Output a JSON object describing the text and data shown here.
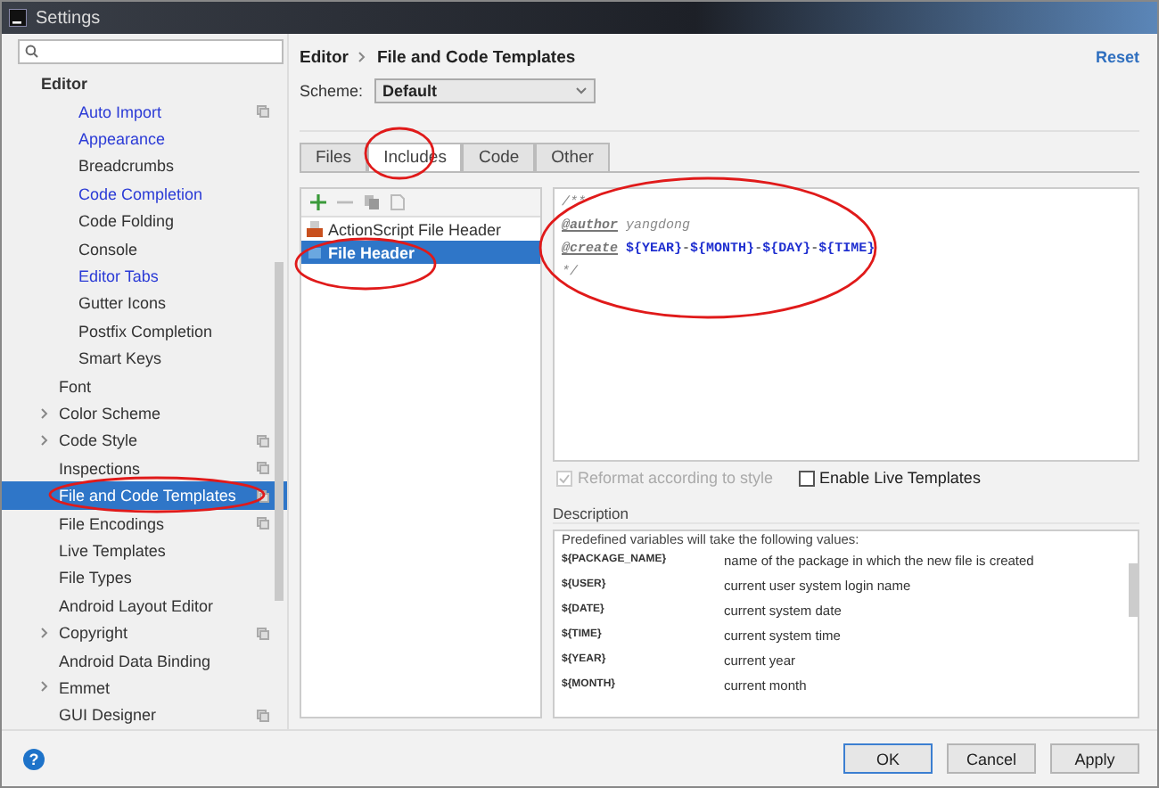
{
  "window": {
    "title": "Settings"
  },
  "sidebar": {
    "items": [
      {
        "label": "Editor",
        "bold": true,
        "expandable": false,
        "copy": false,
        "modified": false,
        "selected": false,
        "circled": false,
        "children": [
          {
            "label": "Auto Import",
            "modified": true,
            "copy": true,
            "selected": false,
            "circled": false
          },
          {
            "label": "Appearance",
            "modified": true,
            "copy": false,
            "selected": false,
            "circled": false
          },
          {
            "label": "Breadcrumbs",
            "modified": false,
            "copy": false,
            "selected": false,
            "circled": false
          },
          {
            "label": "Code Completion",
            "modified": true,
            "copy": false,
            "selected": false,
            "circled": false
          },
          {
            "label": "Code Folding",
            "modified": false,
            "copy": false,
            "selected": false,
            "circled": false
          },
          {
            "label": "Console",
            "modified": false,
            "copy": false,
            "selected": false,
            "circled": false
          },
          {
            "label": "Editor Tabs",
            "modified": true,
            "copy": false,
            "selected": false,
            "circled": false
          },
          {
            "label": "Gutter Icons",
            "modified": false,
            "copy": false,
            "selected": false,
            "circled": false
          },
          {
            "label": "Postfix Completion",
            "modified": false,
            "copy": false,
            "selected": false,
            "circled": false
          },
          {
            "label": "Smart Keys",
            "modified": false,
            "copy": false,
            "selected": false,
            "circled": false
          }
        ]
      },
      {
        "label": "Font",
        "expandable": false,
        "copy": false,
        "modified": false,
        "selected": false,
        "circled": false
      },
      {
        "label": "Color Scheme",
        "expandable": true,
        "copy": false,
        "modified": false,
        "selected": false,
        "circled": false
      },
      {
        "label": "Code Style",
        "expandable": true,
        "copy": true,
        "modified": false,
        "selected": false,
        "circled": false
      },
      {
        "label": "Inspections",
        "expandable": false,
        "copy": true,
        "modified": false,
        "selected": false,
        "circled": false
      },
      {
        "label": "File and Code Templates",
        "expandable": false,
        "copy": true,
        "modified": false,
        "selected": true,
        "circled": true
      },
      {
        "label": "File Encodings",
        "expandable": false,
        "copy": true,
        "modified": false,
        "selected": false,
        "circled": false
      },
      {
        "label": "Live Templates",
        "expandable": false,
        "copy": false,
        "modified": false,
        "selected": false,
        "circled": false
      },
      {
        "label": "File Types",
        "expandable": false,
        "copy": false,
        "modified": false,
        "selected": false,
        "circled": false
      },
      {
        "label": "Android Layout Editor",
        "expandable": false,
        "copy": false,
        "modified": false,
        "selected": false,
        "circled": false
      },
      {
        "label": "Copyright",
        "expandable": true,
        "copy": true,
        "modified": false,
        "selected": false,
        "circled": false
      },
      {
        "label": "Android Data Binding",
        "expandable": false,
        "copy": false,
        "modified": false,
        "selected": false,
        "circled": false
      },
      {
        "label": "Emmet",
        "expandable": true,
        "copy": false,
        "modified": false,
        "selected": false,
        "circled": false
      },
      {
        "label": "GUI Designer",
        "expandable": false,
        "copy": true,
        "modified": false,
        "selected": false,
        "circled": false
      }
    ]
  },
  "breadcrumb": [
    "Editor",
    "File and Code Templates"
  ],
  "reset": "Reset",
  "scheme": {
    "label": "Scheme:",
    "value": "Default"
  },
  "tabs": [
    {
      "label": "Files",
      "selected": false,
      "circled": false
    },
    {
      "label": "Includes",
      "selected": true,
      "circled": true
    },
    {
      "label": "Code",
      "selected": false,
      "circled": false
    },
    {
      "label": "Other",
      "selected": false,
      "circled": false
    }
  ],
  "templates": [
    {
      "label": "ActionScript File Header",
      "kind": "actionscript",
      "selected": false,
      "circled": false
    },
    {
      "label": "File Header",
      "kind": "file",
      "selected": true,
      "circled": true
    }
  ],
  "editor": {
    "circled": true,
    "lines": [
      [
        {
          "kind": "comment",
          "text": "/**"
        }
      ],
      [
        {
          "kind": "tag",
          "text": "@author"
        },
        {
          "kind": "comment",
          "text": "yangdong"
        }
      ],
      [
        {
          "kind": "tag",
          "text": "@create"
        },
        {
          "kind": "variable",
          "text": "${YEAR}"
        },
        {
          "kind": "plain",
          "text": "-"
        },
        {
          "kind": "variable",
          "text": "${MONTH}"
        },
        {
          "kind": "plain",
          "text": "-"
        },
        {
          "kind": "variable",
          "text": "${DAY}"
        },
        {
          "kind": "plain",
          "text": "-"
        },
        {
          "kind": "variable",
          "text": "${TIME}"
        }
      ],
      [
        {
          "kind": "comment",
          "text": "*/"
        }
      ]
    ]
  },
  "options": [
    {
      "label": "Reformat according to style",
      "checked": true,
      "disabled": true
    },
    {
      "label": "Enable Live Templates",
      "checked": false,
      "disabled": false
    }
  ],
  "description": {
    "title": "Description",
    "intro": "Predefined variables will take the following values:",
    "rows": [
      {
        "name": "${PACKAGE_NAME}",
        "text": "name of the package in which the new file is created"
      },
      {
        "name": "${USER}",
        "text": "current user system login name"
      },
      {
        "name": "${DATE}",
        "text": "current system date"
      },
      {
        "name": "${TIME}",
        "text": "current system time"
      },
      {
        "name": "${YEAR}",
        "text": "current year"
      },
      {
        "name": "${MONTH}",
        "text": "current month"
      }
    ]
  },
  "help": "?",
  "buttons": [
    {
      "label": "OK",
      "default": true
    },
    {
      "label": "Cancel",
      "default": false
    },
    {
      "label": "Apply",
      "default": false
    }
  ]
}
